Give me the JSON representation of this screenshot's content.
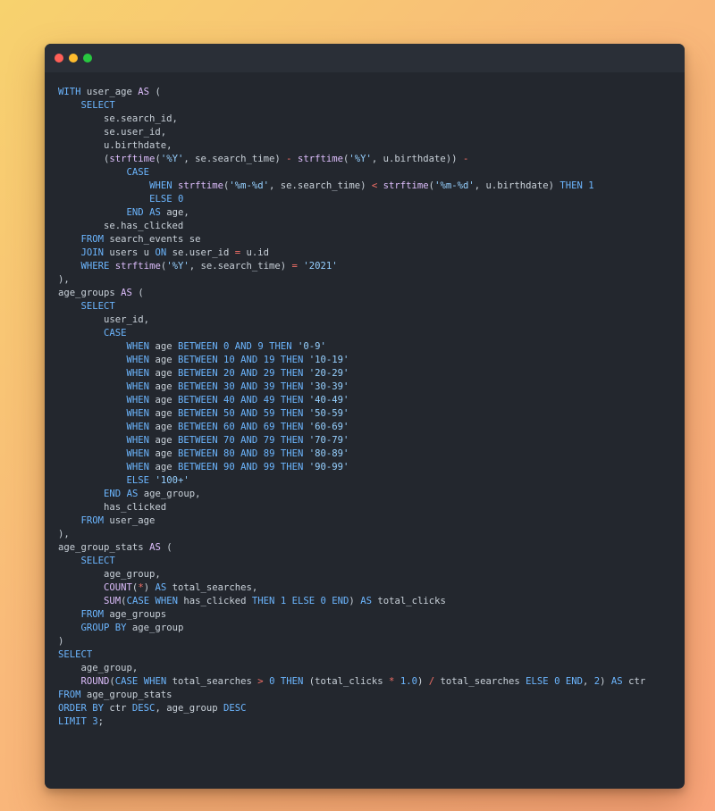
{
  "window": {
    "controls": [
      "close",
      "minimize",
      "maximize"
    ],
    "colors": {
      "close": "#ff5f57",
      "minimize": "#febc2e",
      "maximize": "#28c840",
      "background": "#23272e"
    }
  },
  "code": {
    "language": "sql",
    "lines": [
      [
        [
          "kw",
          "WITH"
        ],
        [
          "pl",
          " user_age "
        ],
        [
          "as",
          "AS"
        ],
        [
          "pl",
          " ("
        ]
      ],
      [
        [
          "pl",
          "    "
        ],
        [
          "kw",
          "SELECT"
        ]
      ],
      [
        [
          "pl",
          "        se.search_id,"
        ]
      ],
      [
        [
          "pl",
          "        se.user_id,"
        ]
      ],
      [
        [
          "pl",
          "        u.birthdate,"
        ]
      ],
      [
        [
          "pl",
          "        ("
        ],
        [
          "fn",
          "strftime"
        ],
        [
          "pl",
          "("
        ],
        [
          "str",
          "'%Y'"
        ],
        [
          "pl",
          ", se.search_time) "
        ],
        [
          "op",
          "-"
        ],
        [
          "pl",
          " "
        ],
        [
          "fn",
          "strftime"
        ],
        [
          "pl",
          "("
        ],
        [
          "str",
          "'%Y'"
        ],
        [
          "pl",
          ", u.birthdate)) "
        ],
        [
          "op",
          "-"
        ]
      ],
      [
        [
          "pl",
          "            "
        ],
        [
          "kw",
          "CASE"
        ]
      ],
      [
        [
          "pl",
          "                "
        ],
        [
          "kw",
          "WHEN"
        ],
        [
          "pl",
          " "
        ],
        [
          "fn",
          "strftime"
        ],
        [
          "pl",
          "("
        ],
        [
          "str",
          "'%m-%d'"
        ],
        [
          "pl",
          ", se.search_time) "
        ],
        [
          "op",
          "<"
        ],
        [
          "pl",
          " "
        ],
        [
          "fn",
          "strftime"
        ],
        [
          "pl",
          "("
        ],
        [
          "str",
          "'%m-%d'"
        ],
        [
          "pl",
          ", u.birthdate) "
        ],
        [
          "kw",
          "THEN"
        ],
        [
          "pl",
          " "
        ],
        [
          "num",
          "1"
        ]
      ],
      [
        [
          "pl",
          "                "
        ],
        [
          "kw",
          "ELSE"
        ],
        [
          "pl",
          " "
        ],
        [
          "num",
          "0"
        ]
      ],
      [
        [
          "pl",
          "            "
        ],
        [
          "kw",
          "END"
        ],
        [
          "pl",
          " "
        ],
        [
          "kw",
          "AS"
        ],
        [
          "pl",
          " age,"
        ]
      ],
      [
        [
          "pl",
          "        se.has_clicked"
        ]
      ],
      [
        [
          "pl",
          "    "
        ],
        [
          "kw",
          "FROM"
        ],
        [
          "pl",
          " search_events se"
        ]
      ],
      [
        [
          "pl",
          "    "
        ],
        [
          "kw",
          "JOIN"
        ],
        [
          "pl",
          " users u "
        ],
        [
          "kw",
          "ON"
        ],
        [
          "pl",
          " se.user_id "
        ],
        [
          "op",
          "="
        ],
        [
          "pl",
          " u.id"
        ]
      ],
      [
        [
          "pl",
          "    "
        ],
        [
          "kw",
          "WHERE"
        ],
        [
          "pl",
          " "
        ],
        [
          "fn",
          "strftime"
        ],
        [
          "pl",
          "("
        ],
        [
          "str",
          "'%Y'"
        ],
        [
          "pl",
          ", se.search_time) "
        ],
        [
          "op",
          "="
        ],
        [
          "pl",
          " "
        ],
        [
          "str",
          "'2021'"
        ]
      ],
      [
        [
          "pl",
          "),"
        ]
      ],
      [
        [
          "pl",
          "age_groups "
        ],
        [
          "as",
          "AS"
        ],
        [
          "pl",
          " ("
        ]
      ],
      [
        [
          "pl",
          "    "
        ],
        [
          "kw",
          "SELECT"
        ]
      ],
      [
        [
          "pl",
          "        user_id,"
        ]
      ],
      [
        [
          "pl",
          "        "
        ],
        [
          "kw",
          "CASE"
        ]
      ],
      [
        [
          "pl",
          "            "
        ],
        [
          "kw",
          "WHEN"
        ],
        [
          "pl",
          " age "
        ],
        [
          "kw",
          "BETWEEN"
        ],
        [
          "pl",
          " "
        ],
        [
          "num",
          "0"
        ],
        [
          "pl",
          " "
        ],
        [
          "kw",
          "AND"
        ],
        [
          "pl",
          " "
        ],
        [
          "num",
          "9"
        ],
        [
          "pl",
          " "
        ],
        [
          "kw",
          "THEN"
        ],
        [
          "pl",
          " "
        ],
        [
          "str",
          "'0-9'"
        ]
      ],
      [
        [
          "pl",
          "            "
        ],
        [
          "kw",
          "WHEN"
        ],
        [
          "pl",
          " age "
        ],
        [
          "kw",
          "BETWEEN"
        ],
        [
          "pl",
          " "
        ],
        [
          "num",
          "10"
        ],
        [
          "pl",
          " "
        ],
        [
          "kw",
          "AND"
        ],
        [
          "pl",
          " "
        ],
        [
          "num",
          "19"
        ],
        [
          "pl",
          " "
        ],
        [
          "kw",
          "THEN"
        ],
        [
          "pl",
          " "
        ],
        [
          "str",
          "'10-19'"
        ]
      ],
      [
        [
          "pl",
          "            "
        ],
        [
          "kw",
          "WHEN"
        ],
        [
          "pl",
          " age "
        ],
        [
          "kw",
          "BETWEEN"
        ],
        [
          "pl",
          " "
        ],
        [
          "num",
          "20"
        ],
        [
          "pl",
          " "
        ],
        [
          "kw",
          "AND"
        ],
        [
          "pl",
          " "
        ],
        [
          "num",
          "29"
        ],
        [
          "pl",
          " "
        ],
        [
          "kw",
          "THEN"
        ],
        [
          "pl",
          " "
        ],
        [
          "str",
          "'20-29'"
        ]
      ],
      [
        [
          "pl",
          "            "
        ],
        [
          "kw",
          "WHEN"
        ],
        [
          "pl",
          " age "
        ],
        [
          "kw",
          "BETWEEN"
        ],
        [
          "pl",
          " "
        ],
        [
          "num",
          "30"
        ],
        [
          "pl",
          " "
        ],
        [
          "kw",
          "AND"
        ],
        [
          "pl",
          " "
        ],
        [
          "num",
          "39"
        ],
        [
          "pl",
          " "
        ],
        [
          "kw",
          "THEN"
        ],
        [
          "pl",
          " "
        ],
        [
          "str",
          "'30-39'"
        ]
      ],
      [
        [
          "pl",
          "            "
        ],
        [
          "kw",
          "WHEN"
        ],
        [
          "pl",
          " age "
        ],
        [
          "kw",
          "BETWEEN"
        ],
        [
          "pl",
          " "
        ],
        [
          "num",
          "40"
        ],
        [
          "pl",
          " "
        ],
        [
          "kw",
          "AND"
        ],
        [
          "pl",
          " "
        ],
        [
          "num",
          "49"
        ],
        [
          "pl",
          " "
        ],
        [
          "kw",
          "THEN"
        ],
        [
          "pl",
          " "
        ],
        [
          "str",
          "'40-49'"
        ]
      ],
      [
        [
          "pl",
          "            "
        ],
        [
          "kw",
          "WHEN"
        ],
        [
          "pl",
          " age "
        ],
        [
          "kw",
          "BETWEEN"
        ],
        [
          "pl",
          " "
        ],
        [
          "num",
          "50"
        ],
        [
          "pl",
          " "
        ],
        [
          "kw",
          "AND"
        ],
        [
          "pl",
          " "
        ],
        [
          "num",
          "59"
        ],
        [
          "pl",
          " "
        ],
        [
          "kw",
          "THEN"
        ],
        [
          "pl",
          " "
        ],
        [
          "str",
          "'50-59'"
        ]
      ],
      [
        [
          "pl",
          "            "
        ],
        [
          "kw",
          "WHEN"
        ],
        [
          "pl",
          " age "
        ],
        [
          "kw",
          "BETWEEN"
        ],
        [
          "pl",
          " "
        ],
        [
          "num",
          "60"
        ],
        [
          "pl",
          " "
        ],
        [
          "kw",
          "AND"
        ],
        [
          "pl",
          " "
        ],
        [
          "num",
          "69"
        ],
        [
          "pl",
          " "
        ],
        [
          "kw",
          "THEN"
        ],
        [
          "pl",
          " "
        ],
        [
          "str",
          "'60-69'"
        ]
      ],
      [
        [
          "pl",
          "            "
        ],
        [
          "kw",
          "WHEN"
        ],
        [
          "pl",
          " age "
        ],
        [
          "kw",
          "BETWEEN"
        ],
        [
          "pl",
          " "
        ],
        [
          "num",
          "70"
        ],
        [
          "pl",
          " "
        ],
        [
          "kw",
          "AND"
        ],
        [
          "pl",
          " "
        ],
        [
          "num",
          "79"
        ],
        [
          "pl",
          " "
        ],
        [
          "kw",
          "THEN"
        ],
        [
          "pl",
          " "
        ],
        [
          "str",
          "'70-79'"
        ]
      ],
      [
        [
          "pl",
          "            "
        ],
        [
          "kw",
          "WHEN"
        ],
        [
          "pl",
          " age "
        ],
        [
          "kw",
          "BETWEEN"
        ],
        [
          "pl",
          " "
        ],
        [
          "num",
          "80"
        ],
        [
          "pl",
          " "
        ],
        [
          "kw",
          "AND"
        ],
        [
          "pl",
          " "
        ],
        [
          "num",
          "89"
        ],
        [
          "pl",
          " "
        ],
        [
          "kw",
          "THEN"
        ],
        [
          "pl",
          " "
        ],
        [
          "str",
          "'80-89'"
        ]
      ],
      [
        [
          "pl",
          "            "
        ],
        [
          "kw",
          "WHEN"
        ],
        [
          "pl",
          " age "
        ],
        [
          "kw",
          "BETWEEN"
        ],
        [
          "pl",
          " "
        ],
        [
          "num",
          "90"
        ],
        [
          "pl",
          " "
        ],
        [
          "kw",
          "AND"
        ],
        [
          "pl",
          " "
        ],
        [
          "num",
          "99"
        ],
        [
          "pl",
          " "
        ],
        [
          "kw",
          "THEN"
        ],
        [
          "pl",
          " "
        ],
        [
          "str",
          "'90-99'"
        ]
      ],
      [
        [
          "pl",
          "            "
        ],
        [
          "kw",
          "ELSE"
        ],
        [
          "pl",
          " "
        ],
        [
          "str",
          "'100+'"
        ]
      ],
      [
        [
          "pl",
          "        "
        ],
        [
          "kw",
          "END"
        ],
        [
          "pl",
          " "
        ],
        [
          "kw",
          "AS"
        ],
        [
          "pl",
          " age_group,"
        ]
      ],
      [
        [
          "pl",
          "        has_clicked"
        ]
      ],
      [
        [
          "pl",
          "    "
        ],
        [
          "kw",
          "FROM"
        ],
        [
          "pl",
          " user_age"
        ]
      ],
      [
        [
          "pl",
          "),"
        ]
      ],
      [
        [
          "pl",
          "age_group_stats "
        ],
        [
          "as",
          "AS"
        ],
        [
          "pl",
          " ("
        ]
      ],
      [
        [
          "pl",
          "    "
        ],
        [
          "kw",
          "SELECT"
        ]
      ],
      [
        [
          "pl",
          "        age_group,"
        ]
      ],
      [
        [
          "pl",
          "        "
        ],
        [
          "fn",
          "COUNT"
        ],
        [
          "pl",
          "("
        ],
        [
          "op",
          "*"
        ],
        [
          "pl",
          ") "
        ],
        [
          "kw",
          "AS"
        ],
        [
          "pl",
          " total_searches,"
        ]
      ],
      [
        [
          "pl",
          "        "
        ],
        [
          "fn",
          "SUM"
        ],
        [
          "pl",
          "("
        ],
        [
          "kw",
          "CASE"
        ],
        [
          "pl",
          " "
        ],
        [
          "kw",
          "WHEN"
        ],
        [
          "pl",
          " has_clicked "
        ],
        [
          "kw",
          "THEN"
        ],
        [
          "pl",
          " "
        ],
        [
          "num",
          "1"
        ],
        [
          "pl",
          " "
        ],
        [
          "kw",
          "ELSE"
        ],
        [
          "pl",
          " "
        ],
        [
          "num",
          "0"
        ],
        [
          "pl",
          " "
        ],
        [
          "kw",
          "END"
        ],
        [
          "pl",
          ") "
        ],
        [
          "kw",
          "AS"
        ],
        [
          "pl",
          " total_clicks"
        ]
      ],
      [
        [
          "pl",
          "    "
        ],
        [
          "kw",
          "FROM"
        ],
        [
          "pl",
          " age_groups"
        ]
      ],
      [
        [
          "pl",
          "    "
        ],
        [
          "kw",
          "GROUP BY"
        ],
        [
          "pl",
          " age_group"
        ]
      ],
      [
        [
          "pl",
          ")"
        ]
      ],
      [
        [
          "kw",
          "SELECT"
        ]
      ],
      [
        [
          "pl",
          "    age_group,"
        ]
      ],
      [
        [
          "pl",
          "    "
        ],
        [
          "fn",
          "ROUND"
        ],
        [
          "pl",
          "("
        ],
        [
          "kw",
          "CASE"
        ],
        [
          "pl",
          " "
        ],
        [
          "kw",
          "WHEN"
        ],
        [
          "pl",
          " total_searches "
        ],
        [
          "op",
          ">"
        ],
        [
          "pl",
          " "
        ],
        [
          "num",
          "0"
        ],
        [
          "pl",
          " "
        ],
        [
          "kw",
          "THEN"
        ],
        [
          "pl",
          " (total_clicks "
        ],
        [
          "op",
          "*"
        ],
        [
          "pl",
          " "
        ],
        [
          "num",
          "1.0"
        ],
        [
          "pl",
          ") "
        ],
        [
          "op",
          "/"
        ],
        [
          "pl",
          " total_searches "
        ],
        [
          "kw",
          "ELSE"
        ],
        [
          "pl",
          " "
        ],
        [
          "num",
          "0"
        ],
        [
          "pl",
          " "
        ],
        [
          "kw",
          "END"
        ],
        [
          "pl",
          ", "
        ],
        [
          "num",
          "2"
        ],
        [
          "pl",
          ") "
        ],
        [
          "kw",
          "AS"
        ],
        [
          "pl",
          " ctr"
        ]
      ],
      [
        [
          "kw",
          "FROM"
        ],
        [
          "pl",
          " age_group_stats"
        ]
      ],
      [
        [
          "kw",
          "ORDER BY"
        ],
        [
          "pl",
          " ctr "
        ],
        [
          "kw",
          "DESC"
        ],
        [
          "pl",
          ", age_group "
        ],
        [
          "kw",
          "DESC"
        ]
      ],
      [
        [
          "kw",
          "LIMIT"
        ],
        [
          "pl",
          " "
        ],
        [
          "num",
          "3"
        ],
        [
          "pl",
          ";"
        ]
      ]
    ]
  }
}
